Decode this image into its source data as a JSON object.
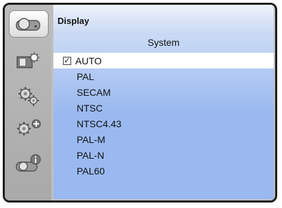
{
  "sidebar": {
    "items": [
      {
        "icon": "display-icon",
        "active": true
      },
      {
        "icon": "picture-adjust-icon",
        "active": false
      },
      {
        "icon": "settings-gear-icon",
        "active": false
      },
      {
        "icon": "extended-settings-icon",
        "active": false
      },
      {
        "icon": "information-icon",
        "active": false
      }
    ]
  },
  "header": {
    "title": "Display"
  },
  "panel": {
    "subtitle": "System"
  },
  "menu": {
    "items": [
      {
        "label": "AUTO",
        "checked": true
      },
      {
        "label": "PAL"
      },
      {
        "label": "SECAM"
      },
      {
        "label": "NTSC"
      },
      {
        "label": "NTSC4.43"
      },
      {
        "label": "PAL-M"
      },
      {
        "label": "PAL-N"
      },
      {
        "label": "PAL60"
      }
    ]
  },
  "colors": {
    "frame_border": "#1c1c1c",
    "sidebar_bg": "#b3b3b3",
    "panel_blue": "#9ab9f0",
    "selected_bg": "#ffffff"
  }
}
